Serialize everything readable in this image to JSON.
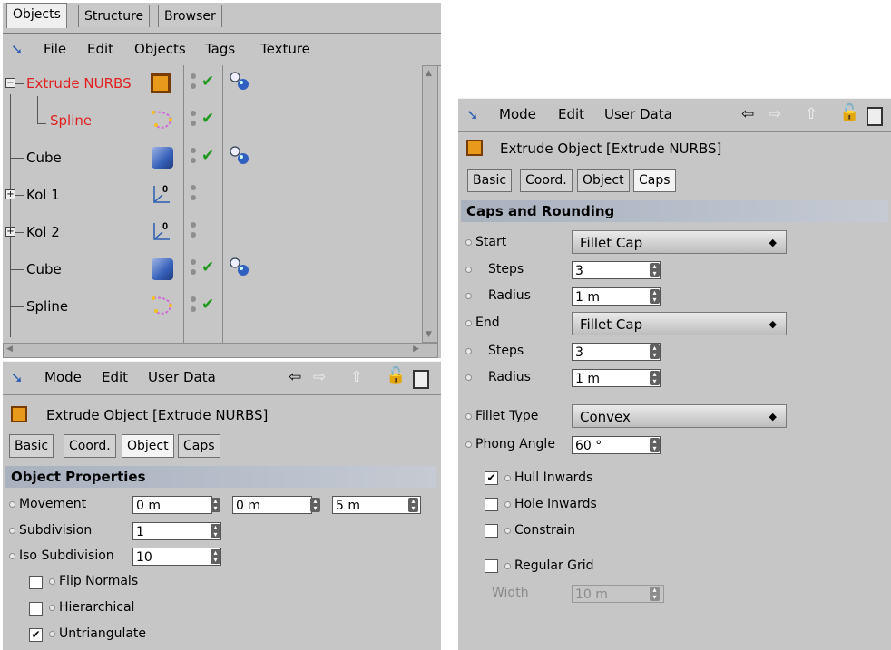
{
  "objects_panel": {
    "tabs": [
      "Objects",
      "Structure",
      "Browser"
    ],
    "menu": [
      "File",
      "Edit",
      "Objects",
      "Tags",
      "Texture"
    ],
    "tree": [
      {
        "name": "Extrude NURBS",
        "expander": "−",
        "color": "#e02020",
        "icon": "extrude-icon",
        "check": true,
        "tag": "phong-tag-icon"
      },
      {
        "name": "Spline",
        "expander": "",
        "color": "#e02020",
        "icon": "spline-icon",
        "check": true,
        "tag": ""
      },
      {
        "name": "Cube",
        "expander": "",
        "color": "#000000",
        "icon": "cube-icon",
        "check": true,
        "tag": "phong-tag-icon"
      },
      {
        "name": "Kol 1",
        "expander": "+",
        "color": "#000000",
        "icon": "null-icon",
        "check": false,
        "tag": ""
      },
      {
        "name": "Kol 2",
        "expander": "+",
        "color": "#000000",
        "icon": "null-icon",
        "check": false,
        "tag": ""
      },
      {
        "name": "Cube",
        "expander": "",
        "color": "#000000",
        "icon": "cube-icon",
        "check": true,
        "tag": "phong-tag-icon"
      },
      {
        "name": "Spline",
        "expander": "",
        "color": "#000000",
        "icon": "spline-icon",
        "check": true,
        "tag": ""
      }
    ]
  },
  "attr_left": {
    "menu": [
      "Mode",
      "Edit",
      "User Data"
    ],
    "title": "Extrude Object [Extrude NURBS]",
    "tabs": [
      "Basic",
      "Coord.",
      "Object",
      "Caps"
    ],
    "active_tab": "Object",
    "section": "Object Properties",
    "movement_label": "Movement",
    "movement": [
      "0 m",
      "0 m",
      "5 m"
    ],
    "subdivision_label": "Subdivision",
    "subdivision": "1",
    "iso_label": "Iso Subdivision",
    "iso": "10",
    "checks": [
      {
        "label": "Flip Normals",
        "checked": false
      },
      {
        "label": "Hierarchical",
        "checked": false
      },
      {
        "label": "Untriangulate",
        "checked": true
      }
    ]
  },
  "attr_right": {
    "menu": [
      "Mode",
      "Edit",
      "User Data"
    ],
    "title": "Extrude Object [Extrude NURBS]",
    "tabs": [
      "Basic",
      "Coord.",
      "Object",
      "Caps"
    ],
    "active_tab": "Caps",
    "section": "Caps and Rounding",
    "start_label": "Start",
    "start_value": "Fillet Cap",
    "start_steps_label": "Steps",
    "start_steps": "3",
    "start_radius_label": "Radius",
    "start_radius": "1 m",
    "end_label": "End",
    "end_value": "Fillet Cap",
    "end_steps_label": "Steps",
    "end_steps": "3",
    "end_radius_label": "Radius",
    "end_radius": "1 m",
    "fillet_type_label": "Fillet Type",
    "fillet_type": "Convex",
    "phong_label": "Phong Angle",
    "phong": "60 °",
    "checks": [
      {
        "label": "Hull Inwards",
        "checked": true
      },
      {
        "label": "Hole Inwards",
        "checked": false
      },
      {
        "label": "Constrain",
        "checked": false
      },
      {
        "label": "Regular Grid",
        "checked": false
      }
    ],
    "width_label": "Width",
    "width_value": "10 m"
  },
  "colors": {
    "panel_bg": "#c6c6c6",
    "header_gradient": "#a9b1bf",
    "check_green": "#1f9a1f",
    "active_red": "#e02020"
  }
}
